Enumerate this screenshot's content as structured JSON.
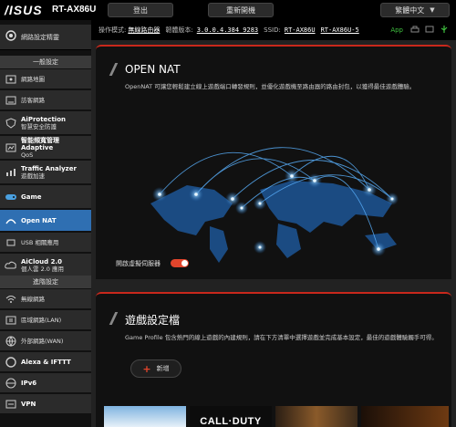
{
  "header": {
    "logo": "/ISUS",
    "model": "RT-AX86U",
    "logout_label": "登出",
    "reboot_label": "重新開機",
    "language": "繁體中文"
  },
  "status": {
    "mode_label": "操作模式:",
    "mode_value": "無線路由器",
    "firmware_label": "韌體版本:",
    "firmware_value": "3.0.0.4.384_9283",
    "ssid_label": "SSID:",
    "ssid_1": "RT-AX86U",
    "ssid_2": "RT-AX86U-5",
    "app_label": "App"
  },
  "sidebar": {
    "quick_label": "網路設定精靈",
    "general_header": "一般設定",
    "advanced_header": "進階設定",
    "items": [
      {
        "label": "網路地圖",
        "bold": ""
      },
      {
        "label": "訪客網路",
        "bold": ""
      },
      {
        "label": "智慧安全防護",
        "bold": "AiProtection"
      },
      {
        "label": "QoS",
        "bold": "智能頻寬管理 Adaptive"
      },
      {
        "label": "遊戲加速",
        "bold": "Traffic Analyzer"
      },
      {
        "label": "",
        "bold": "Game"
      },
      {
        "label": "",
        "bold": "Open NAT"
      },
      {
        "label": "USB 相關應用",
        "bold": ""
      },
      {
        "label": "個人雲 2.0 應用",
        "bold": "AiCloud 2.0"
      }
    ],
    "advanced_items": [
      {
        "label": "無線網路",
        "bold": ""
      },
      {
        "label": "區域網路(LAN)",
        "bold": ""
      },
      {
        "label": "外部網路(WAN)",
        "bold": ""
      },
      {
        "label": "",
        "bold": "Alexa & IFTTT"
      },
      {
        "label": "",
        "bold": "IPv6"
      },
      {
        "label": "",
        "bold": "VPN"
      }
    ]
  },
  "open_nat": {
    "title": "OPEN NAT",
    "description": "OpenNAT 可讓您輕鬆建立線上遊戲端口轉發規則，並優化遊戲機至路由器的路由封包，以獲得最佳遊戲體驗。",
    "toggle_label": "開啟虛擬伺服器"
  },
  "game_profile": {
    "title": "遊戲設定檔",
    "description": "Game Profile 包含熱門的線上遊戲的內建規則，請在下方清單中選擇遊戲並完成基本設定，最佳的遊戲體驗觸手可得。",
    "add_label": "新增",
    "game_logo": "CALL·DUTY"
  }
}
